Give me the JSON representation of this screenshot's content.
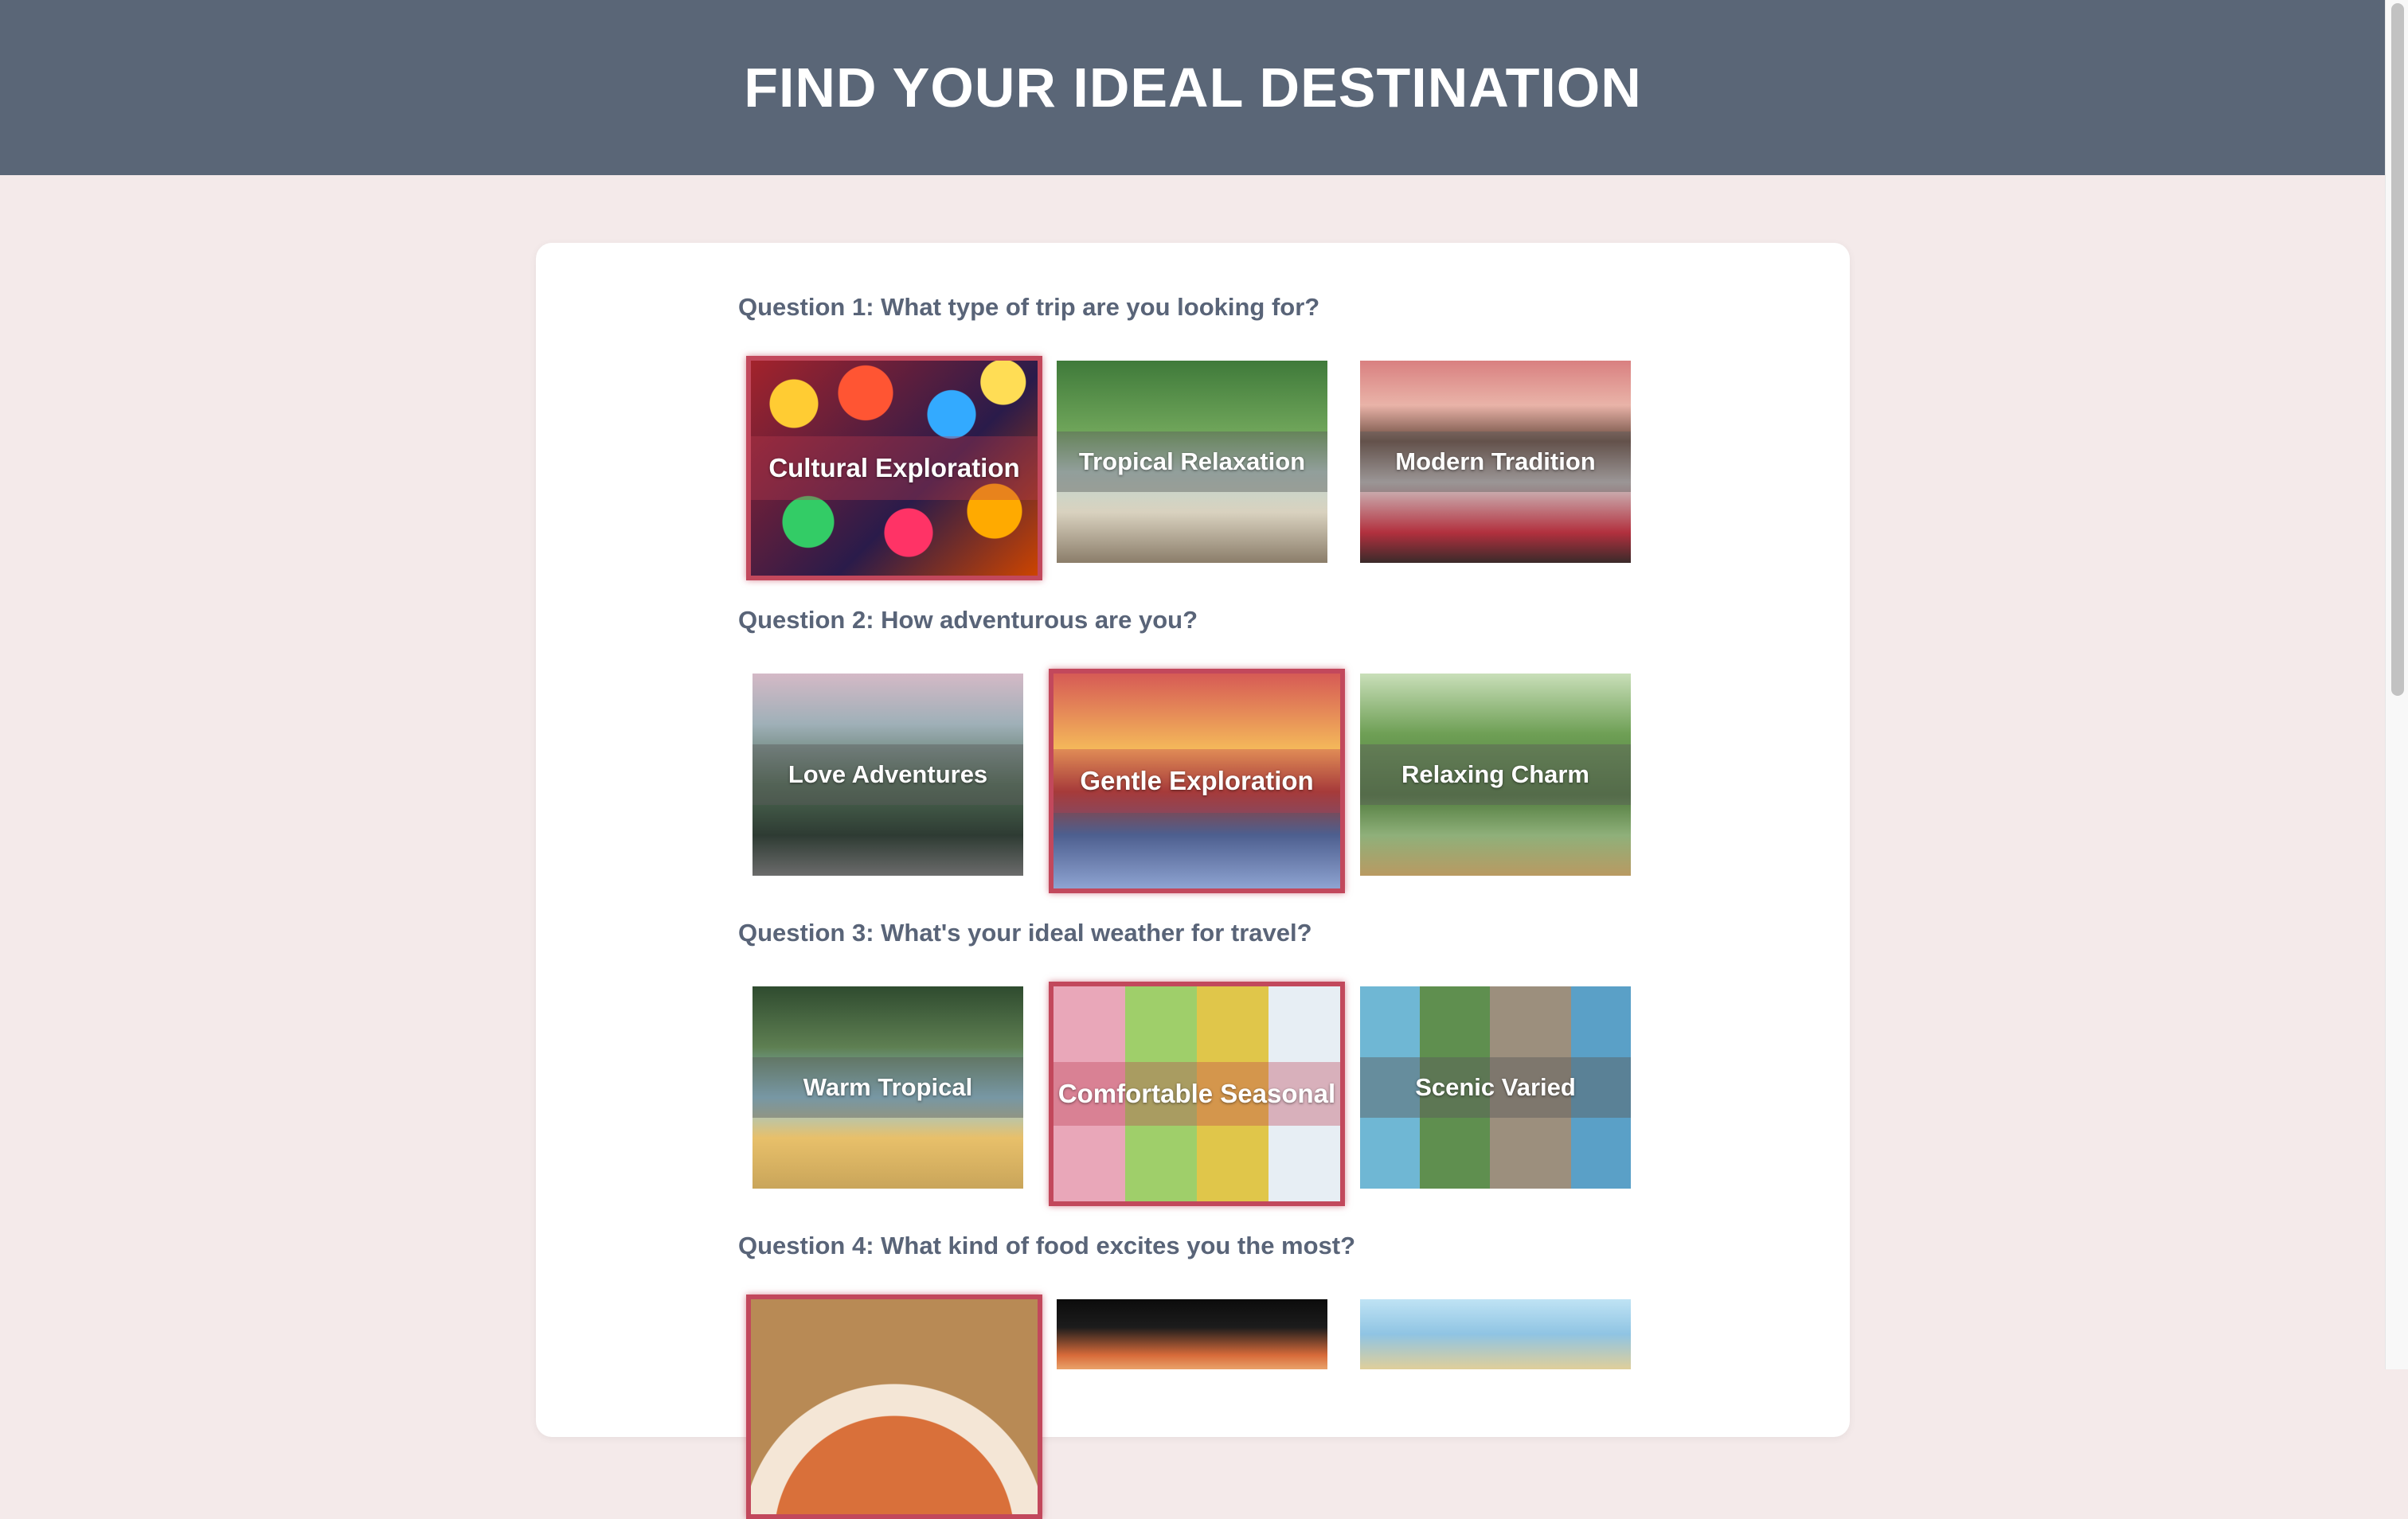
{
  "header": {
    "title": "FIND YOUR IDEAL DESTINATION"
  },
  "questions": [
    {
      "text": "Question 1: What type of trip are you looking for?",
      "options": [
        {
          "label": "Cultural Exploration",
          "selected": true,
          "image": "lanterns-photo"
        },
        {
          "label": "Tropical Relaxation",
          "selected": false,
          "image": "tropical-shore-photo"
        },
        {
          "label": "Modern Tradition",
          "selected": false,
          "image": "geisha-photo"
        }
      ]
    },
    {
      "text": "Question 2: How adventurous are you?",
      "options": [
        {
          "label": "Love Adventures",
          "selected": false,
          "image": "mountain-hiker-photo"
        },
        {
          "label": "Gentle Exploration",
          "selected": true,
          "image": "torii-gate-photo"
        },
        {
          "label": "Relaxing Charm",
          "selected": false,
          "image": "bamboo-raft-photo"
        }
      ]
    },
    {
      "text": "Question 3: What's your ideal weather for travel?",
      "options": [
        {
          "label": "Warm Tropical",
          "selected": false,
          "image": "palm-beach-photo"
        },
        {
          "label": "Comfortable Seasonal",
          "selected": true,
          "image": "four-seasons-photo"
        },
        {
          "label": "Scenic Varied",
          "selected": false,
          "image": "varied-landscapes-photo"
        }
      ]
    },
    {
      "text": "Question 4: What kind of food excites you the most?",
      "options": [
        {
          "label": "",
          "selected": true,
          "image": "noodle-bowl-photo"
        },
        {
          "label": "",
          "selected": false,
          "image": "sushi-platter-photo"
        },
        {
          "label": "",
          "selected": false,
          "image": "seaside-dish-photo"
        }
      ]
    }
  ],
  "colors": {
    "header_bg": "#5a6677",
    "page_bg": "#f4eaea",
    "question_text": "#596478",
    "selected_border": "#c2485c"
  }
}
